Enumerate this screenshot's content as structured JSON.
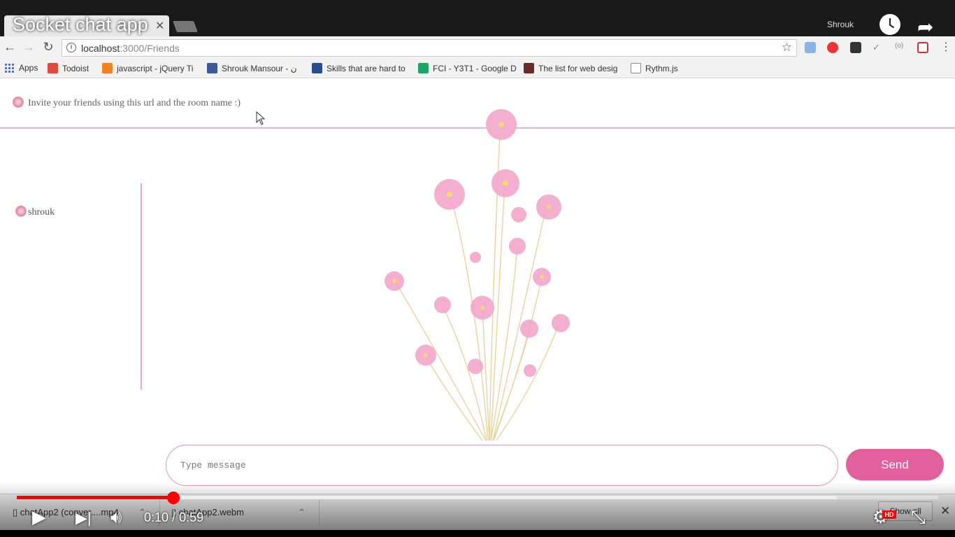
{
  "video": {
    "title": "Socket chat app",
    "channel": "Shrouk",
    "time_current": "0:10",
    "time_total": "0:59",
    "time_separator": " / ",
    "played_fraction": 0.17,
    "buffered_fraction": 0.89,
    "hd_label": "HD",
    "icons": [
      "watch-later-icon",
      "share-icon",
      "play-icon",
      "next-icon",
      "volume-icon",
      "settings-icon",
      "exit-fullscreen-icon"
    ]
  },
  "browser": {
    "url_host": "localhost",
    "url_path": ":3000/Friends",
    "bookmarks": [
      {
        "label": "Apps",
        "color": "#3b6cd6"
      },
      {
        "label": "Todoist",
        "color": "#db4c3f"
      },
      {
        "label": "javascript - jQuery Ti",
        "color": "#f48024"
      },
      {
        "label": "Shrouk Mansour - ن",
        "color": "#3b5998"
      },
      {
        "label": "Skills that are hard to",
        "color": "#2a4b8d"
      },
      {
        "label": "FCI - Y3T1 - Google D",
        "color": "#1fa463"
      },
      {
        "label": "The list for web desig",
        "color": "#6b2a2a"
      },
      {
        "label": "Rythm.js",
        "color": "#888888"
      }
    ]
  },
  "app": {
    "invite_text": "Invite your friends using this url and the room name :)",
    "user_name": "shrouk",
    "message_placeholder": "Type message",
    "send_label": "Send",
    "accent_color": "#e2609b",
    "border_color": "#e7a9c1"
  },
  "downloads": {
    "items": [
      {
        "name": "chatApp2 (conver....mp4"
      },
      {
        "name": "chatApp2.webm"
      }
    ],
    "show_all": "Show all"
  }
}
